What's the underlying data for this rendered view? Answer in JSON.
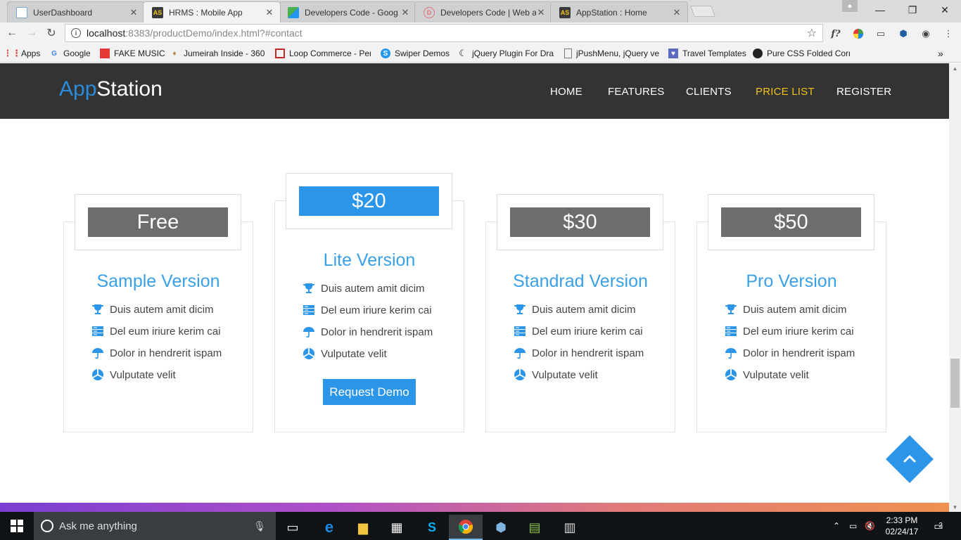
{
  "browser": {
    "tabs": [
      {
        "title": "UserDashboard",
        "favicon": "doc-icon",
        "active": false
      },
      {
        "title": "HRMS : Mobile App",
        "favicon": "as-icon",
        "active": true
      },
      {
        "title": "Developers Code - Goog",
        "favicon": "maps-icon",
        "active": false
      },
      {
        "title": "Developers Code | Web a",
        "favicon": "dc-icon",
        "active": false
      },
      {
        "title": "AppStation : Home",
        "favicon": "as-icon",
        "active": false
      }
    ],
    "url_host": "localhost",
    "url_path": ":8383/productDemo/index.html?#contact",
    "bookmarks": [
      {
        "label": "Apps"
      },
      {
        "label": "Google"
      },
      {
        "label": "FAKE MUSIC"
      },
      {
        "label": "Jumeirah Inside - 360"
      },
      {
        "label": "Loop Commerce - Per"
      },
      {
        "label": "Swiper Demos"
      },
      {
        "label": "jQuery Plugin For Dra"
      },
      {
        "label": "jPushMenu, jQuery ve"
      },
      {
        "label": "Travel Templates"
      },
      {
        "label": "Pure CSS Folded Corn"
      }
    ],
    "ext_f_label": "f?",
    "overflow": "»"
  },
  "site": {
    "logo_app": "App",
    "logo_station": "Station",
    "nav": [
      {
        "label": "HOME"
      },
      {
        "label": "FEATURES"
      },
      {
        "label": "CLIENTS"
      },
      {
        "label": "PRICE LIST",
        "active": true
      },
      {
        "label": "REGISTER"
      }
    ],
    "plans": [
      {
        "price": "Free",
        "name": "Sample Version"
      },
      {
        "price": "$20",
        "name": "Lite Version",
        "button": "Request Demo"
      },
      {
        "price": "$30",
        "name": "Standrad Version"
      },
      {
        "price": "$50",
        "name": "Pro Version"
      }
    ],
    "features": [
      {
        "label": "Duis autem amit dicim",
        "icon": "trophy-icon"
      },
      {
        "label": "Del eum iriure kerim cai",
        "icon": "server-icon"
      },
      {
        "label": "Dolor in hendrerit ispam",
        "icon": "umbrella-icon"
      },
      {
        "label": "Vulputate velit",
        "icon": "pie-chart-icon"
      }
    ],
    "accent_color": "#2b95e9",
    "highlight_color": "#f2c21a"
  },
  "taskbar": {
    "search_placeholder": "Ask me anything",
    "time": "2:33 PM",
    "date": "02/24/17",
    "notification_count": "2"
  }
}
